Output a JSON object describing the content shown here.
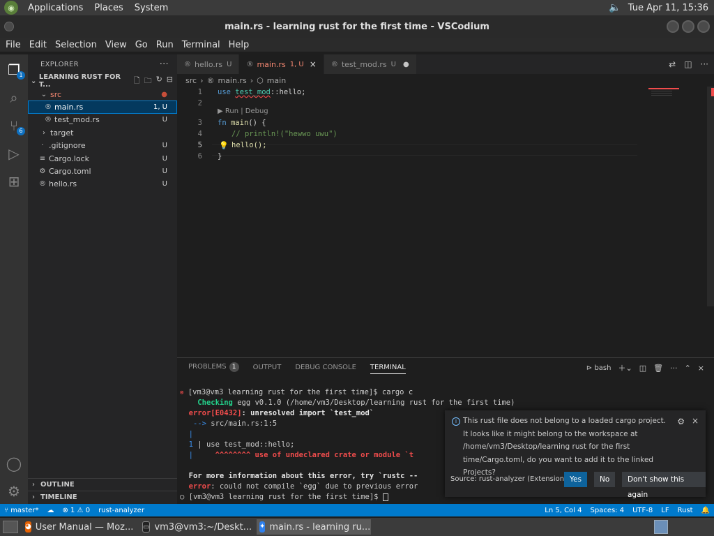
{
  "top_panel": {
    "menus": [
      "Applications",
      "Places",
      "System"
    ],
    "clock": "Tue Apr 11, 15:36",
    "icons": [
      "distro-logo-icon",
      "volume-icon"
    ]
  },
  "window": {
    "title": "main.rs - learning rust for the first time - VSCodium"
  },
  "menubar": [
    "File",
    "Edit",
    "Selection",
    "View",
    "Go",
    "Run",
    "Terminal",
    "Help"
  ],
  "activity": {
    "icons": [
      "explorer-icon",
      "search-icon",
      "source-control-icon",
      "run-debug-icon",
      "extensions-icon",
      "account-icon",
      "settings-gear-icon"
    ],
    "explorer_badge": "1",
    "scm_badge": "6"
  },
  "explorer": {
    "title": "EXPLORER",
    "project": "LEARNING RUST FOR T...",
    "tree": [
      {
        "label": "src",
        "status": "●",
        "kind": "folder-open"
      },
      {
        "label": "main.rs",
        "status": "1, U",
        "kind": "rust-file"
      },
      {
        "label": "test_mod.rs",
        "status": "U",
        "kind": "rust-file"
      },
      {
        "label": "target",
        "status": "",
        "kind": "folder"
      },
      {
        "label": ".gitignore",
        "status": "U",
        "kind": "file"
      },
      {
        "label": "Cargo.lock",
        "status": "U",
        "kind": "file"
      },
      {
        "label": "Cargo.toml",
        "status": "U",
        "kind": "gear-file"
      },
      {
        "label": "hello.rs",
        "status": "U",
        "kind": "rust-file"
      }
    ],
    "outline": "OUTLINE",
    "timeline": "TIMELINE"
  },
  "tabs": [
    {
      "label": "hello.rs",
      "status": "U"
    },
    {
      "label": "main.rs",
      "status": "1, U"
    },
    {
      "label": "test_mod.rs",
      "status": "U"
    }
  ],
  "breadcrumb": {
    "folder": "src",
    "file": "main.rs",
    "symbol": "main"
  },
  "editor": {
    "line_numbers": [
      "1",
      "2",
      "3",
      "4",
      "5",
      "6"
    ],
    "code_lens": "▶ Run | Debug",
    "line1": {
      "kw": "use",
      "mod": "test_mod",
      "rest": "::hello;"
    },
    "line3": {
      "kw": "fn",
      "name": "main",
      "rest": "() {"
    },
    "line4": "// println!(\"hewwo uwu\")",
    "line5": "hello();",
    "line6": "}"
  },
  "panel": {
    "tabs": [
      "PROBLEMS",
      "OUTPUT",
      "DEBUG CONSOLE",
      "TERMINAL"
    ],
    "problems_count": "1",
    "shell": "bash",
    "terminal": {
      "prompt1": "[vm3@vm3 learning rust for the first time]$ cargo c",
      "checking_word": "Checking",
      "checking_rest": " egg v0.1.0 (/home/vm3/Desktop/learning rust for the first time)",
      "error_code": "error[E0432]",
      "error_msg": ": unresolved import `test_mod`",
      "arrow": " --> ",
      "location": "src/main.rs:1:5",
      "pipe": "  |",
      "line_no": "1",
      "source": " | use test_mod::hello;",
      "carets": "     ^^^^^^^^ use of undeclared crate or module `t",
      "more_info": "For more information about this error, try `rustc --",
      "error_word": "error",
      "compile_msg": ": could not compile `egg` due to previous error",
      "prompt2": "[vm3@vm3 learning rust for the first time]$ "
    }
  },
  "notification": {
    "message": "This rust file does not belong to a loaded cargo project. It looks like it might belong to the workspace at /home/vm3/Desktop/learning rust for the first time/Cargo.toml, do you want to add it to the linked Projects?",
    "source": "Source: rust-analyzer (Extension)",
    "yes": "Yes",
    "no": "No",
    "dont_show": "Don't show this again"
  },
  "statusbar": {
    "branch": "master*",
    "problems": "⊗ 1 ⚠ 0",
    "analyzer": "rust-analyzer",
    "position": "Ln 5, Col 4",
    "spaces": "Spaces: 4",
    "encoding": "UTF-8",
    "eol": "LF",
    "language": "Rust"
  },
  "taskbar": {
    "tasks": [
      "User Manual — Moz...",
      "vm3@vm3:~/Deskt...",
      "main.rs - learning ru..."
    ]
  }
}
